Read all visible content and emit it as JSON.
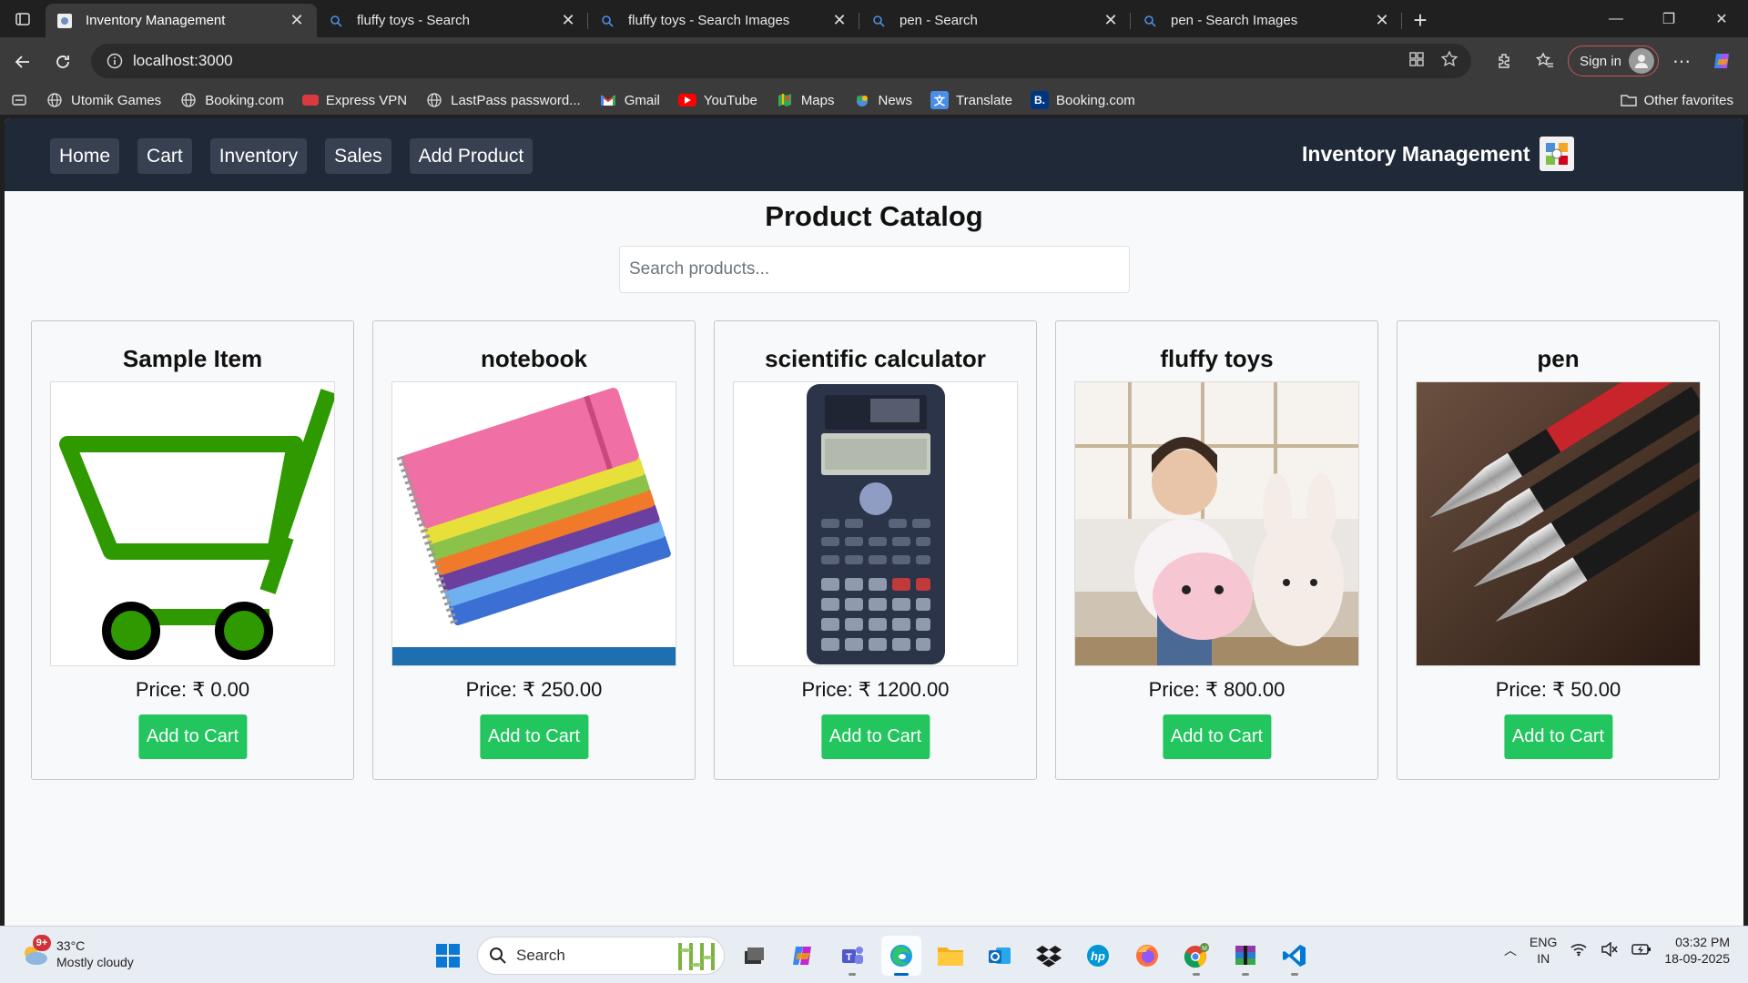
{
  "browser": {
    "tabs": [
      {
        "title": "Inventory Management",
        "icon": "inventory-favicon",
        "active": true
      },
      {
        "title": "fluffy toys - Search",
        "icon": "search-icon",
        "active": false
      },
      {
        "title": "fluffy toys - Search Images",
        "icon": "search-icon",
        "active": false
      },
      {
        "title": "pen - Search",
        "icon": "search-icon",
        "active": false
      },
      {
        "title": "pen - Search Images",
        "icon": "search-icon",
        "active": false
      }
    ],
    "url": "localhost:3000",
    "signin_label": "Sign in",
    "bookmarks": [
      {
        "label": "Utomik Games",
        "icon": "globe-icon"
      },
      {
        "label": "Booking.com",
        "icon": "globe-icon"
      },
      {
        "label": "Express VPN",
        "icon": "expressvpn-icon"
      },
      {
        "label": "LastPass password...",
        "icon": "globe-icon"
      },
      {
        "label": "Gmail",
        "icon": "gmail-icon"
      },
      {
        "label": "YouTube",
        "icon": "youtube-icon"
      },
      {
        "label": "Maps",
        "icon": "maps-icon"
      },
      {
        "label": "News",
        "icon": "news-icon"
      },
      {
        "label": "Translate",
        "icon": "translate-icon"
      },
      {
        "label": "Booking.com",
        "icon": "booking-icon"
      }
    ],
    "other_favorites": "Other favorites"
  },
  "app": {
    "nav": [
      "Home",
      "Cart",
      "Inventory",
      "Sales",
      "Add Product"
    ],
    "brand": "Inventory Management",
    "heading": "Product Catalog",
    "search_placeholder": "Search products...",
    "add_to_cart_label": "Add to Cart",
    "products": [
      {
        "name": "Sample Item",
        "price": "Price: ₹ 0.00",
        "image": "shopping-cart-image"
      },
      {
        "name": "notebook",
        "price": "Price: ₹ 250.00",
        "image": "notebook-stack-image"
      },
      {
        "name": "scientific calculator",
        "price": "Price: ₹ 1200.00",
        "image": "calculator-image"
      },
      {
        "name": "fluffy toys",
        "price": "Price: ₹ 800.00",
        "image": "plush-toys-image"
      },
      {
        "name": "pen",
        "price": "Price: ₹ 50.00",
        "image": "fountain-pens-image"
      }
    ]
  },
  "taskbar": {
    "weather_temp": "33°C",
    "weather_desc": "Mostly cloudy",
    "weather_badge": "9+",
    "search_label": "Search",
    "lang_line1": "ENG",
    "lang_line2": "IN",
    "time": "03:32 PM",
    "date": "18-09-2025"
  },
  "colors": {
    "nav_bg": "#1f2937",
    "nav_link_bg": "#374151",
    "add_button": "#22c55e",
    "cart_green": "#2e9a00"
  }
}
